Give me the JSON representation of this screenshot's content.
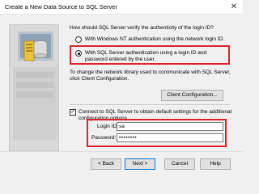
{
  "window": {
    "title": "Create a New Data Source to SQL Server",
    "close_glyph": "✕"
  },
  "auth": {
    "question": "How should SQL Server verify the authenticity of the login ID?",
    "option_nt": "With Windows NT authentication using the network login ID.",
    "option_sql": "With SQL Server authentication using a login ID and password entered by the user.",
    "selected": "sql"
  },
  "network": {
    "info_text": "To change the network library used to communicate with SQL Server, click Client Configuration.",
    "client_config_label": "Client Configuration..."
  },
  "connect": {
    "checkbox_label": "Connect to SQL Server to obtain default settings for the additional configuration options.",
    "checked": true,
    "check_glyph": "✓"
  },
  "credentials": {
    "login_label": "Login ID:",
    "login_value": "sa",
    "password_label": "Password:",
    "password_value": "••••••••"
  },
  "buttons": {
    "back": "< Back",
    "next": "Next >",
    "cancel": "Cancel",
    "help": "Help"
  },
  "colors": {
    "highlight": "#d9242b",
    "accent": "#0078d7"
  },
  "icons": {
    "side_graphic": "database-server-icon"
  }
}
